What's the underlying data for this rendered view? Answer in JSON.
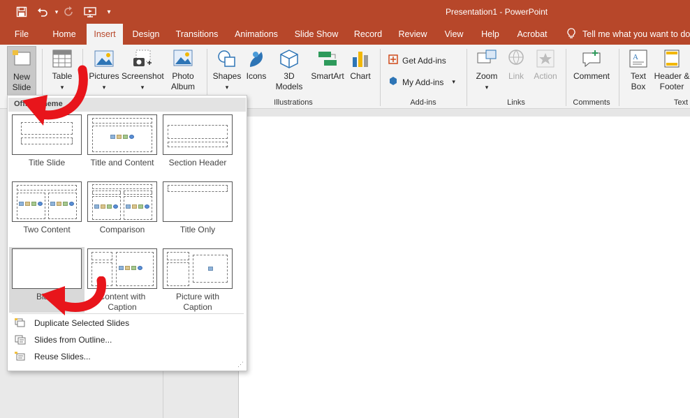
{
  "window": {
    "title": "Presentation1 - PowerPoint",
    "qat_icons": [
      "save-icon",
      "undo-icon",
      "redo-icon",
      "present-icon",
      "customize-icon"
    ]
  },
  "tabs": [
    "File",
    "Home",
    "Insert",
    "Design",
    "Transitions",
    "Animations",
    "Slide Show",
    "Record",
    "Review",
    "View",
    "Help",
    "Acrobat"
  ],
  "active_tab": "Insert",
  "tell_me": "Tell me what you want to do",
  "ribbon": {
    "new_slide": "New Slide",
    "table": "Table",
    "pictures": "Pictures",
    "screenshot": "Screenshot",
    "photo_album": "Photo Album",
    "shapes": "Shapes",
    "icons": "Icons",
    "models_3d": "3D Models",
    "smartart": "SmartArt",
    "chart": "Chart",
    "illustrations_group": "Illustrations",
    "get_addins": "Get Add-ins",
    "my_addins": "My Add-ins",
    "addins_group": "Add-ins",
    "zoom": "Zoom",
    "link": "Link",
    "action": "Action",
    "links_group": "Links",
    "comment": "Comment",
    "comments_group": "Comments",
    "text_box": "Text Box",
    "header_footer": "Header & Footer",
    "text_group": "Text"
  },
  "dropdown": {
    "header": "Office Theme",
    "layouts": [
      {
        "label": "Title Slide"
      },
      {
        "label": "Title and Content"
      },
      {
        "label": "Section Header"
      },
      {
        "label": "Two Content"
      },
      {
        "label": "Comparison"
      },
      {
        "label": "Title Only"
      },
      {
        "label": "Blank"
      },
      {
        "label": "Content with Caption"
      },
      {
        "label": "Picture with Caption"
      }
    ],
    "menu_items": [
      {
        "label": "Duplicate Selected Slides"
      },
      {
        "label": "Slides from Outline..."
      },
      {
        "label": "Reuse Slides..."
      }
    ]
  },
  "colors": {
    "accent": "#b7472a",
    "annotation_arrow": "#e8151b"
  }
}
